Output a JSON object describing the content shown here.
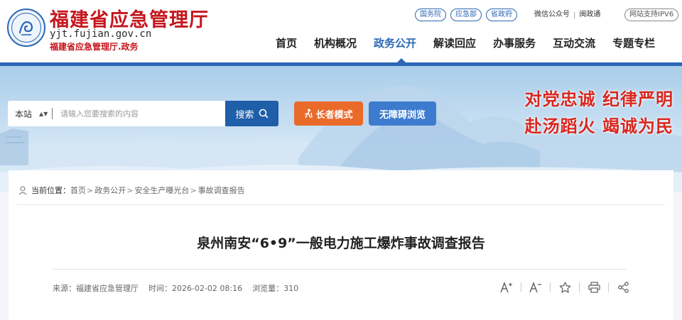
{
  "header": {
    "logo_icon": "fujian-emergency-emblem",
    "title": "福建省应急管理厅",
    "domain": "yjt.fujian.gov.cn",
    "subtitle": "福建省应急管理厅.政务",
    "top_links": [
      "国务院",
      "应急部",
      "省政府"
    ],
    "wechat": "微信公众号",
    "minzhengtong": "闽政通",
    "ipv6": "网站支持IPV6",
    "nav": [
      "首页",
      "机构概况",
      "政务公开",
      "解读回应",
      "办事服务",
      "互动交流",
      "专题专栏"
    ],
    "active_nav": "政务公开",
    "accent_color": "#2b67b3",
    "brand_red": "#c5161d"
  },
  "banner": {
    "search_scope": "本站",
    "search_placeholder": "请输入您要搜索的内容",
    "search_button": "搜索",
    "elder_mode": "长者模式",
    "accessible": "无障碍浏览",
    "slogan_line1": "对党忠诚  纪律严明",
    "slogan_line2": "赴汤蹈火  竭诚为民"
  },
  "breadcrumb": {
    "label": "当前位置：",
    "items": [
      "首页",
      "政务公开",
      "安全生产曝光台",
      "事故调查报告"
    ]
  },
  "article": {
    "title": "泉州南安“6•9”一般电力施工爆炸事故调查报告",
    "source": "来源：福建省应急管理厅",
    "time": "时间：2026-02-02 08:16",
    "views": "浏览量：310"
  },
  "tools": [
    "font-increase-icon",
    "font-decrease-icon",
    "star-icon",
    "print-icon",
    "share-icon"
  ]
}
